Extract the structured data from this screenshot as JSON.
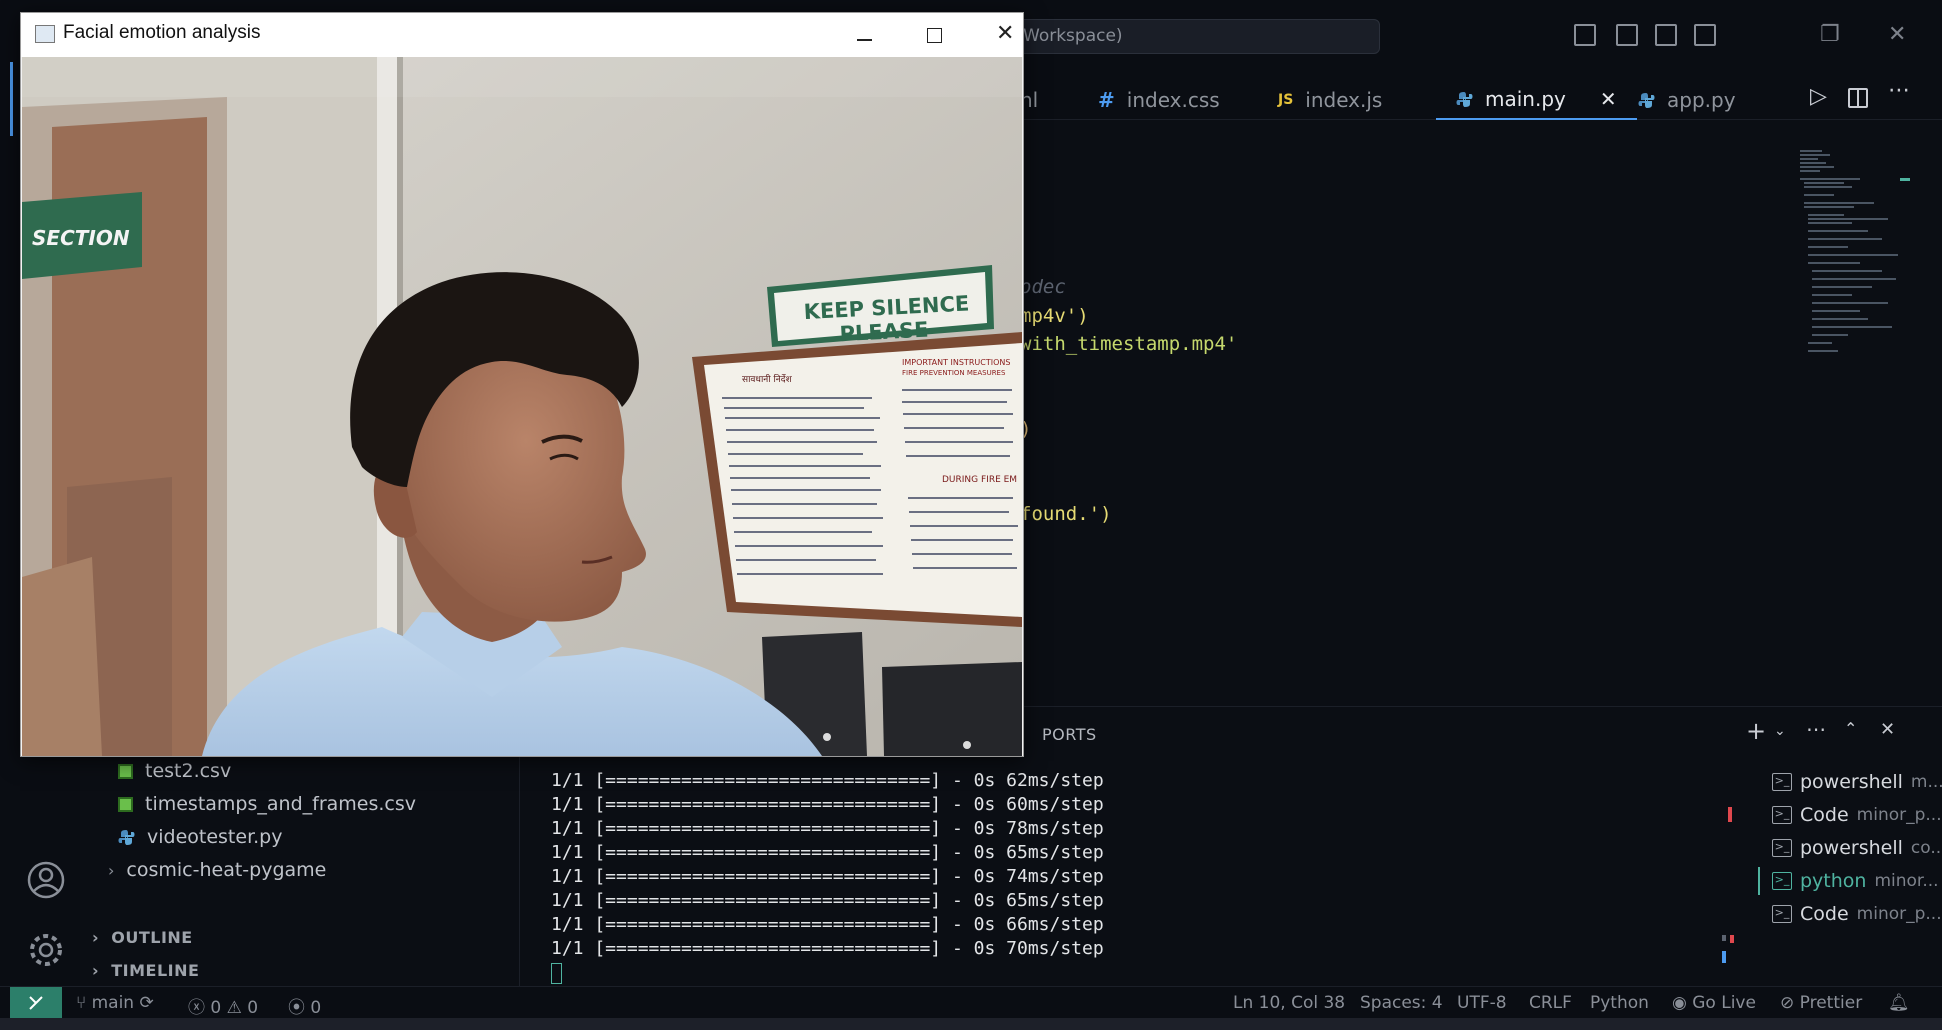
{
  "titlebar": {
    "search_text": "Workspace)"
  },
  "tabs": [
    {
      "label": "nl",
      "icon": "html-icon"
    },
    {
      "label": "index.css",
      "icon": "hash-icon"
    },
    {
      "label": "index.js",
      "icon_text": "JS",
      "label_full": "index.js"
    },
    {
      "label": "main.py",
      "icon": "python-icon",
      "active": true
    },
    {
      "label": "app.py",
      "icon": "python-icon"
    }
  ],
  "editor": {
    "lines": [
      {
        "text": "odec",
        "color": "#5c6370",
        "italic": true
      },
      {
        "text": "mp4v')",
        "color": "#e6db74"
      },
      {
        "text": "with_timestamp.mp4'",
        "color": "#c5d86d"
      },
      {
        "text": ")",
        "color": "#e6c07b"
      },
      {
        "text": "found.')",
        "color": "#e6db74"
      }
    ]
  },
  "sidebar": {
    "files": [
      {
        "name": "test2.csv",
        "type": "csv"
      },
      {
        "name": "timestamps_and_frames.csv",
        "type": "csv"
      },
      {
        "name": "videotester.py",
        "type": "py"
      }
    ],
    "folder": "cosmic-heat-pygame",
    "outline": "OUTLINE",
    "timeline": "TIMELINE"
  },
  "panel": {
    "ports_tab": "PORTS",
    "terminal_lines": [
      "1/1 [==============================] - 0s 62ms/step",
      "1/1 [==============================] - 0s 60ms/step",
      "1/1 [==============================] - 0s 78ms/step",
      "1/1 [==============================] - 0s 65ms/step",
      "1/1 [==============================] - 0s 74ms/step",
      "1/1 [==============================] - 0s 65ms/step",
      "1/1 [==============================] - 0s 66ms/step",
      "1/1 [==============================] - 0s 70ms/step"
    ],
    "terminals": [
      {
        "name": "powershell",
        "sub": "m..."
      },
      {
        "name": "Code",
        "sub": "minor_p..."
      },
      {
        "name": "powershell",
        "sub": "co..."
      },
      {
        "name": "python",
        "sub": "minor...",
        "active": true
      },
      {
        "name": "Code",
        "sub": "minor_p..."
      }
    ]
  },
  "statusbar": {
    "branch": "main",
    "errors": "0",
    "warnings": "0",
    "ports": "0",
    "position": "Ln 10, Col 38",
    "spaces": "Spaces: 4",
    "encoding": "UTF-8",
    "eol": "CRLF",
    "language": "Python",
    "golive": "Go Live",
    "prettier": "Prettier"
  },
  "camera_window": {
    "title": "Facial emotion analysis",
    "sign_section": "SECTION",
    "sign_silence_1": "KEEP SILENCE",
    "sign_silence_2": "PLEASE",
    "notice_heading_left": "सावधानी निर्देश",
    "notice_heading_right": "IMPORTANT INSTRUCTIONS",
    "notice_sub_right": "FIRE PREVENTION MEASURES",
    "notice_mid": "DURING FIRE EM"
  },
  "colors": {
    "accent": "#4d9bf0",
    "remote_bg": "#2c7f6a",
    "sign_green": "#2f6b4f"
  }
}
